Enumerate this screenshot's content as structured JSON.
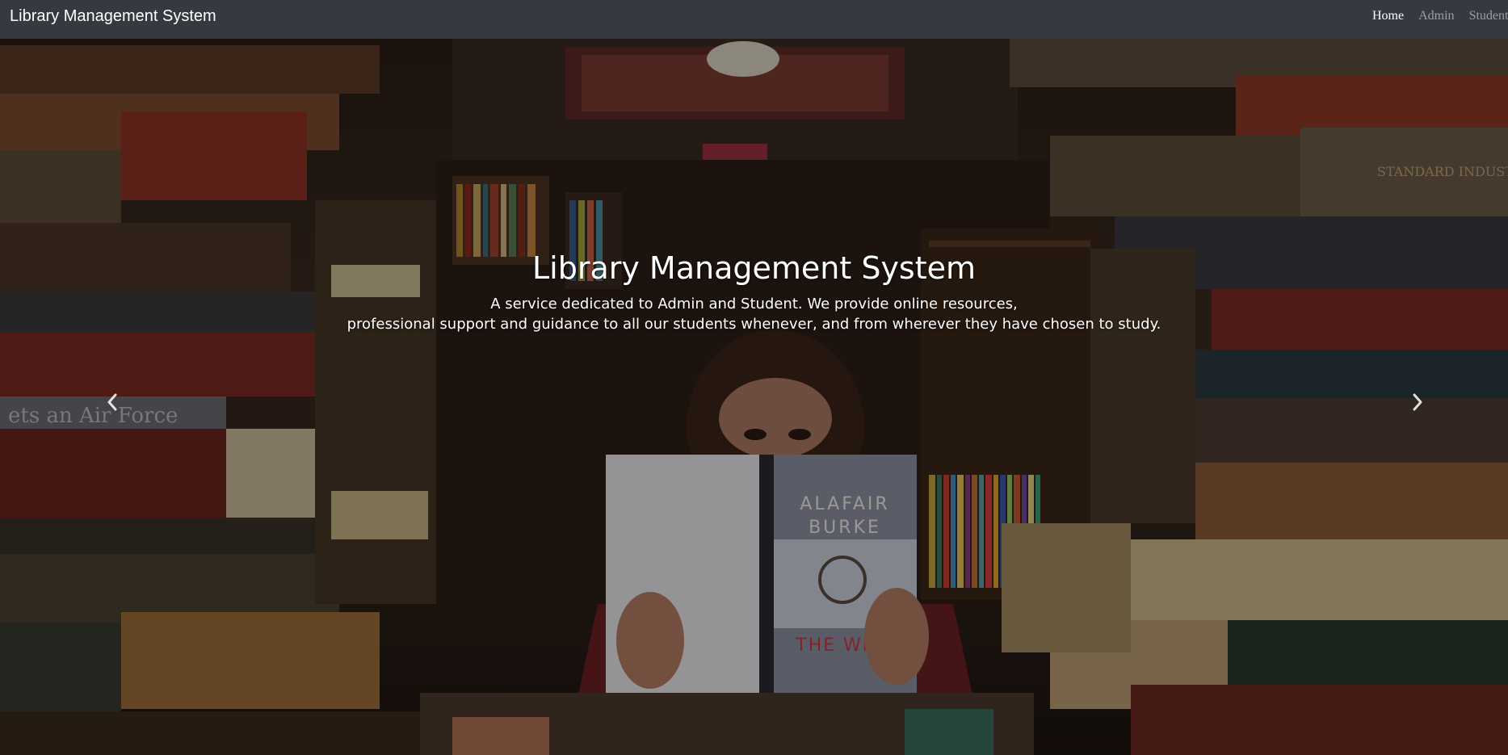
{
  "navbar": {
    "brand": "Library Management System",
    "links": [
      {
        "label": "Home",
        "active": true
      },
      {
        "label": "Admin",
        "active": false
      },
      {
        "label": "Student",
        "active": false
      }
    ],
    "background_color": "#343a40"
  },
  "carousel": {
    "caption": {
      "title": "Library Management System",
      "line1": "A service dedicated to Admin and Student. We provide online resources,",
      "line2": "professional support and guidance to all our students whenever, and from wherever they have chosen to study."
    },
    "prev_icon": "chevron-left-icon",
    "next_icon": "chevron-right-icon",
    "image_description_icon": "library-photo"
  },
  "book_in_photo": {
    "author": "ALAFAIR BURKE",
    "title": "THE WIFE"
  }
}
